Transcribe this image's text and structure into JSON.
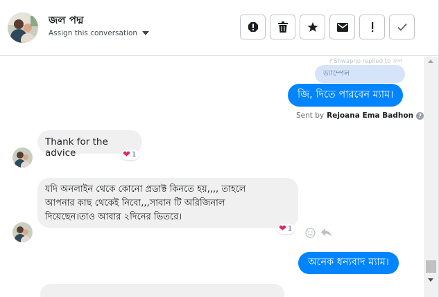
{
  "header": {
    "contact_name": "জল পদ্ম",
    "assign_label": "Assign this conversation",
    "buttons": [
      {
        "name": "spam-button",
        "icon": "alert-octagon-icon"
      },
      {
        "name": "delete-button",
        "icon": "trash-icon"
      },
      {
        "name": "star-button",
        "icon": "star-icon"
      },
      {
        "name": "mark-unread-button",
        "icon": "envelope-icon"
      },
      {
        "name": "follow-up-button",
        "icon": "exclamation-icon"
      },
      {
        "name": "done-button",
        "icon": "checkmark-icon"
      }
    ]
  },
  "messages": {
    "replied_note": "↱Shwapno replied to জল",
    "quoted_text": "ড্যাম্পেল",
    "outgoing_1": "জি, দিতে পারবেন ম্যাম।",
    "sent_by_prefix": "Sent by",
    "sent_by_name": "Rejoana Ema Badhon",
    "incoming_1": "Thank for the advice",
    "incoming_1_reaction_count": "1",
    "incoming_2_line1": "যদি অনলাইন থেকে কোনো  প্রডাক্ট কিনতে হয়,,,, তাহলে",
    "incoming_2_line2": "আপনার কাছ থেকেই নিবো,,,সাবান টি অরিজিনাল",
    "incoming_2_line3": "দিয়েছেন।তাও আবার ২দিনের ভিতরে।",
    "incoming_2_reaction_count": "1",
    "outgoing_2": "অনেক ধন্যবাদ ম্যাম।"
  },
  "colors": {
    "accent": "#0084ff",
    "incoming_bubble": "#f0f0f0",
    "quote_bubble": "#d6e4fa",
    "heart": "#e0245e"
  }
}
